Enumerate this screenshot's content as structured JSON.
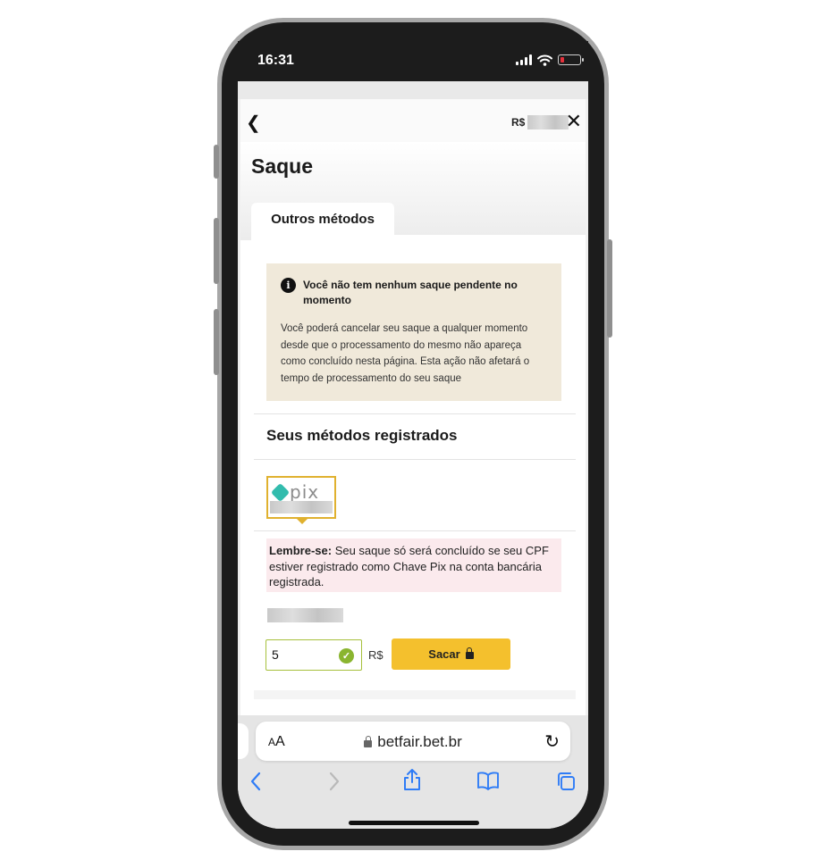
{
  "status_bar": {
    "time": "16:31"
  },
  "nav": {
    "back_icon": "chevron-left-icon",
    "balance_prefix": "R$",
    "close_icon": "close-icon"
  },
  "page": {
    "title": "Saque",
    "tab_label": "Outros métodos"
  },
  "notice": {
    "heading": "Você não tem nenhum saque pendente no momento",
    "body": "Você poderá cancelar seu saque a qualquer momento desde que o processamento do mesmo não apareça como concluído nesta página. Esta ação não afetará o tempo de processamento do seu saque"
  },
  "methods": {
    "section_title": "Seus métodos registrados",
    "pix_logo_text": "pix"
  },
  "reminder": {
    "label": "Lembre-se:",
    "text": " Seu saque só será concluído se seu CPF estiver registrado como Chave Pix na conta bancária registrada."
  },
  "withdraw": {
    "amount_value": "5",
    "currency": "R$",
    "button_label": "Sacar"
  },
  "browser": {
    "aa_small": "A",
    "aa_large": "A",
    "url": "betfair.bet.br"
  },
  "colors": {
    "accent": "#f4c02d",
    "pix": "#32bcad",
    "ios_blue": "#2f7cf6"
  }
}
